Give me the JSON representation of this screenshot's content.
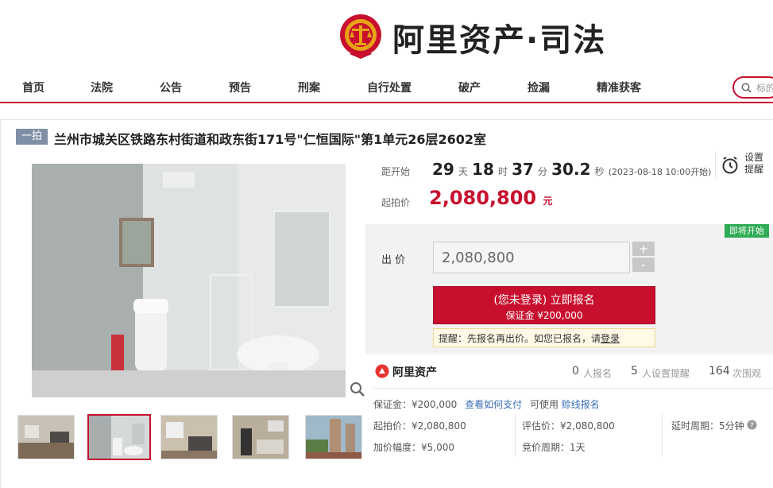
{
  "brand": {
    "logo_text": "阿里资产·司法"
  },
  "nav": {
    "items": [
      "首页",
      "法院",
      "公告",
      "预告",
      "刑案",
      "自行处置",
      "破产",
      "捡漏",
      "精准获客"
    ]
  },
  "search": {
    "placeholder": "标的"
  },
  "auction": {
    "round_tag": "一拍",
    "title": "兰州市城关区铁路东村街道和政东街171号\"仁恒国际\"第1单元26层2602室"
  },
  "countdown": {
    "label": "距开始",
    "days": "29",
    "days_unit": "天",
    "hours": "18",
    "hours_unit": "时",
    "minutes": "37",
    "minutes_unit": "分",
    "seconds": "30.2",
    "seconds_unit": "秒",
    "start_note": "(2023-08-18 10:00开始)"
  },
  "reminder": {
    "label_line1": "设置",
    "label_line2": "提醒"
  },
  "start_price": {
    "label": "起拍价",
    "value": "2,080,800",
    "unit": "元"
  },
  "status_badge": "即将开始",
  "bid": {
    "label": "出 价",
    "value": "2,080,800",
    "plus": "+",
    "minus": "-",
    "register_line1": "(您未登录) 立即报名",
    "register_line2": "保证金 ¥200,000",
    "tip_prefix": "提醒：先报名再出价。如您已报名，请",
    "tip_link": "登录"
  },
  "stats": {
    "brand": "阿里资产",
    "registered_count": "0",
    "registered_label": "人报名",
    "reminder_count": "5",
    "reminder_label": "人设置提醒",
    "views_count": "164",
    "views_label": "次围观"
  },
  "details": {
    "deposit_label": "保证金：¥200,000",
    "how_to_pay": "查看如何支付",
    "usable_label": "可使用",
    "no_deposit_link": "赊线报名",
    "start_price": "起拍价：¥2,080,800",
    "appraisal": "评估价：¥2,080,800",
    "delay_period": "延时周期：5分钟",
    "increment": "加价幅度：¥5,000",
    "bid_period": "竞价周期：1天"
  },
  "colors": {
    "brand_red": "#c8102e",
    "tag_gray": "#7f8fa6",
    "soon_green": "#2eab54"
  }
}
